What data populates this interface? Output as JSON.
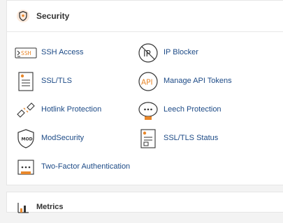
{
  "security": {
    "title": "Security",
    "icon": "shield-icon",
    "items": [
      {
        "label": "SSH Access",
        "icon": "ssh-terminal-icon"
      },
      {
        "label": "IP Blocker",
        "icon": "ip-blocker-icon"
      },
      {
        "label": "SSL/TLS",
        "icon": "ssl-certificate-icon"
      },
      {
        "label": "Manage API Tokens",
        "icon": "api-icon"
      },
      {
        "label": "Hotlink Protection",
        "icon": "broken-link-icon"
      },
      {
        "label": "Leech Protection",
        "icon": "leech-protection-icon"
      },
      {
        "label": "ModSecurity",
        "icon": "mod-shield-icon"
      },
      {
        "label": "SSL/TLS Status",
        "icon": "ssl-status-icon"
      },
      {
        "label": "Two-Factor Authentication",
        "icon": "two-factor-icon"
      }
    ]
  },
  "metrics": {
    "title": "Metrics",
    "icon": "bar-chart-icon"
  },
  "colors": {
    "link": "#1c4a86",
    "accent_orange": "#e8872b",
    "icon_dark": "#333333"
  }
}
